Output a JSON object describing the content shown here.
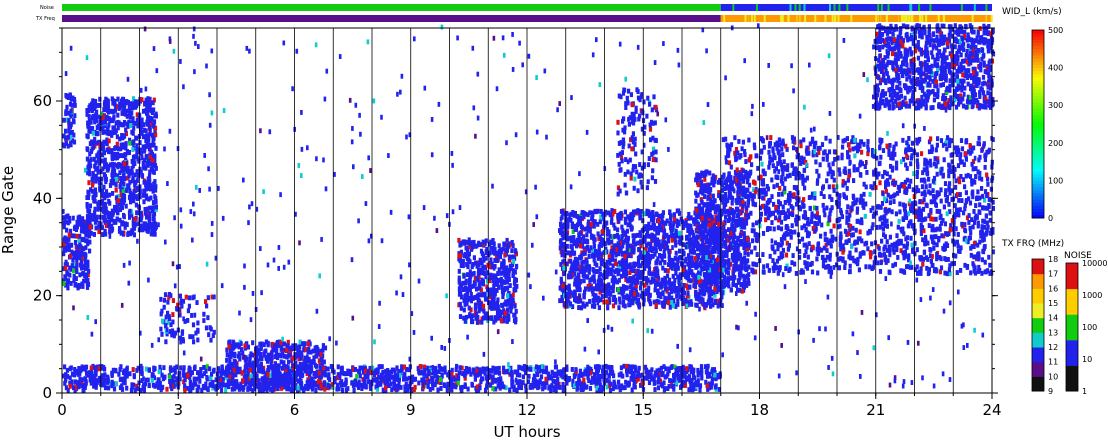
{
  "chart_data": {
    "type": "heatmap",
    "title": "",
    "xlabel": "UT hours",
    "ylabel": "Range Gate",
    "xlim": [
      0,
      24
    ],
    "ylim": [
      0,
      75
    ],
    "xticks": [
      "0",
      "3",
      "6",
      "9",
      "12",
      "15",
      "18",
      "21",
      "24"
    ],
    "yticks": [
      "0",
      "20",
      "40",
      "60"
    ],
    "grid": "vertical lines every hour",
    "series": [
      {
        "name": "WID_L (km/s)",
        "blobs": [
          {
            "x": [
              0.0,
              0.7
            ],
            "y": [
              21,
              36
            ],
            "value": "mostly 0-100"
          },
          {
            "x": [
              0.0,
              0.3
            ],
            "y": [
              50,
              61
            ],
            "value": "mostly 0-100"
          },
          {
            "x": [
              0.6,
              2.4
            ],
            "y": [
              32,
              60
            ],
            "value": "mostly 0-100"
          },
          {
            "x": [
              2.5,
              3.9
            ],
            "y": [
              10,
              20
            ],
            "value": "sparse"
          },
          {
            "x": [
              4.2,
              6.8
            ],
            "y": [
              0,
              10
            ],
            "value": "mostly 0-100"
          },
          {
            "x": [
              0.0,
              17.0
            ],
            "y": [
              0,
              5
            ],
            "value": "mostly 0-100"
          },
          {
            "x": [
              10.2,
              11.7
            ],
            "y": [
              14,
              31
            ],
            "value": "mostly 0-100"
          },
          {
            "x": [
              12.8,
              17.0
            ],
            "y": [
              17,
              37
            ],
            "value": "mostly 0-100"
          },
          {
            "x": [
              16.3,
              17.7
            ],
            "y": [
              20,
              45
            ],
            "value": "mostly 0-100"
          },
          {
            "x": [
              17.0,
              24.0
            ],
            "y": [
              24,
              52
            ],
            "value": "mostly 0-100"
          },
          {
            "x": [
              20.9,
              24.0
            ],
            "y": [
              58,
              75
            ],
            "value": "mostly 0-100"
          },
          {
            "x": [
              14.3,
              15.3
            ],
            "y": [
              40,
              62
            ],
            "value": "sparse"
          }
        ]
      }
    ],
    "side_bars": [
      {
        "name": "Noise",
        "segments": [
          {
            "x": [
              0,
              17
            ],
            "value": "green"
          },
          {
            "x": [
              17,
              24
            ],
            "value": "blue"
          }
        ]
      },
      {
        "name": "TX Freq",
        "segments": [
          {
            "x": [
              0,
              17
            ],
            "value": "purple"
          },
          {
            "x": [
              17,
              24
            ],
            "value": "orange/yellow"
          }
        ]
      }
    ],
    "colorbars": [
      {
        "label": "WID_L (km/s)",
        "ticks": [
          "0",
          "100",
          "200",
          "300",
          "400",
          "500"
        ]
      },
      {
        "label": "TX FRQ (MHz)",
        "ticks": [
          "9",
          "10",
          "11",
          "12",
          "13",
          "14",
          "15",
          "16",
          "17",
          "18"
        ]
      },
      {
        "label": "NOISE",
        "ticks": [
          "1",
          "10",
          "100",
          "1000",
          "10000"
        ]
      }
    ],
    "colors": {
      "blue": "#2222ee",
      "purple": "#5a0f8a",
      "red": "#dd1111",
      "green": "#11cc11",
      "cyan": "#11cccc",
      "orange": "#ff9900",
      "yellow": "#eeee22"
    }
  }
}
